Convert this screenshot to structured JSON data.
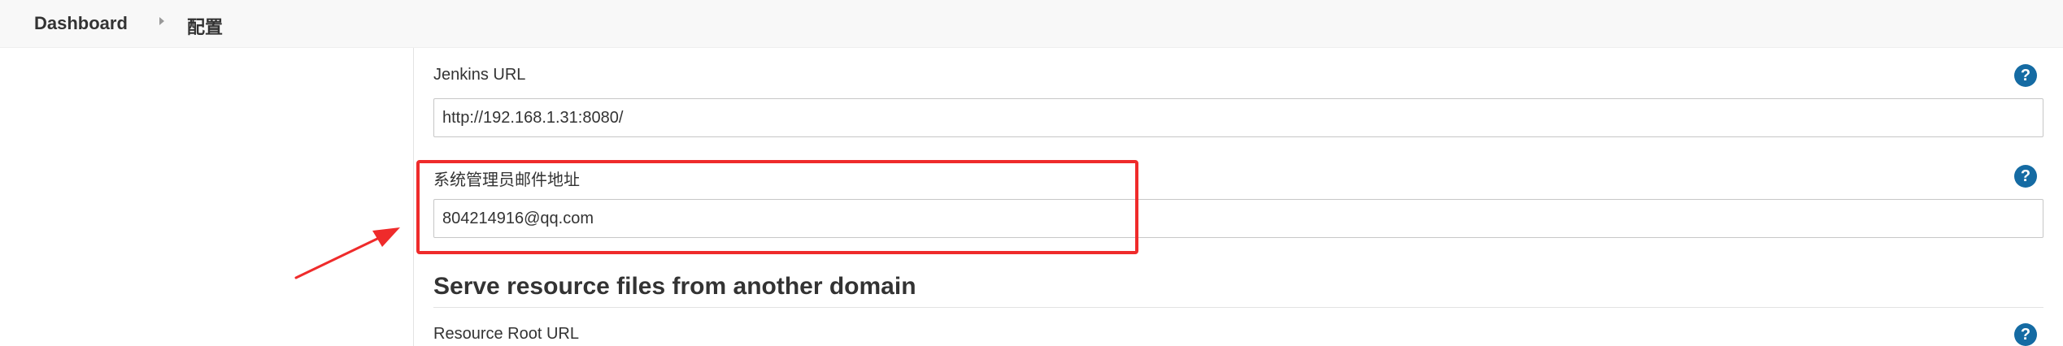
{
  "breadcrumb": {
    "root": "Dashboard",
    "current": "配置"
  },
  "jenkins_url": {
    "label": "Jenkins URL",
    "value": "http://192.168.1.31:8080/",
    "help_icon": "help-icon"
  },
  "admin_email": {
    "label": "系统管理员邮件地址",
    "value": "804214916@qq.com",
    "help_icon": "help-icon"
  },
  "resource_section": {
    "title": "Serve resource files from another domain",
    "root_url_label": "Resource Root URL",
    "help_icon": "help-icon"
  },
  "annotation": {
    "color": "#ef2b2b"
  },
  "colors": {
    "help_icon": "#156ba3",
    "topbar": "#f8f8f8"
  }
}
